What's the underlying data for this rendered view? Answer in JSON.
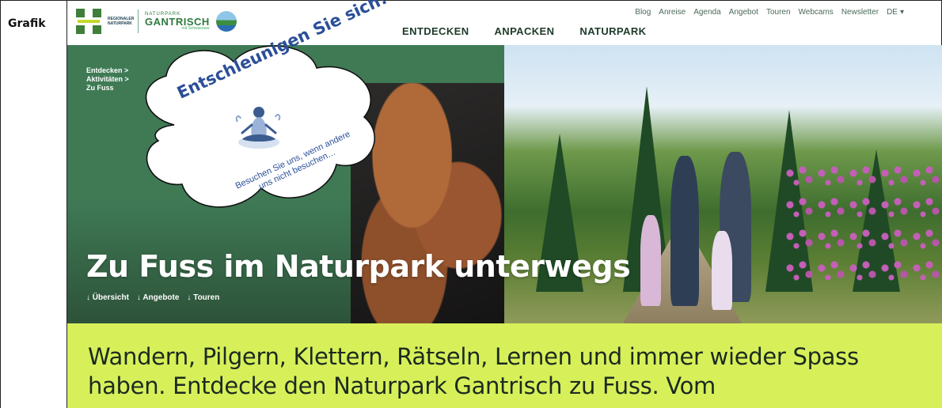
{
  "side_label": "Grafik",
  "logo": {
    "regional_text": "REGIONALER NATURPARK",
    "naturpark_top": "NATURPARK",
    "naturpark_name": "GANTRISCH",
    "naturpark_sub": "mit Schwarzsee"
  },
  "top_nav": [
    "Blog",
    "Anreise",
    "Agenda",
    "Angebot",
    "Touren",
    "Webcams",
    "Newsletter"
  ],
  "language": "DE",
  "main_nav": [
    "ENTDECKEN",
    "ANPACKEN",
    "NATURPARK"
  ],
  "breadcrumb": [
    "Entdecken >",
    "Aktivitäten >",
    "Zu Fuss"
  ],
  "hero": {
    "title": "Zu Fuss im Naturpark unterwegs",
    "anchors": [
      "↓ Übersicht",
      "↓ Angebote",
      "↓ Touren"
    ]
  },
  "cloud": {
    "headline": "Entschleunigen Sie sich!",
    "subline": "Besuchen Sie uns, wenn andere uns nicht besuchen…"
  },
  "intro_text": "Wandern, Pilgern, Klettern, Rätseln, Lernen und immer wieder Spass haben. Entdecke den Naturpark Gantrisch zu Fuss. Vom",
  "colors": {
    "hero_green": "#3f7a55",
    "lime": "#d7f05a",
    "cloud_text": "#2b4f98"
  },
  "icons": [
    "chevron-down-icon",
    "meditation-icon"
  ]
}
